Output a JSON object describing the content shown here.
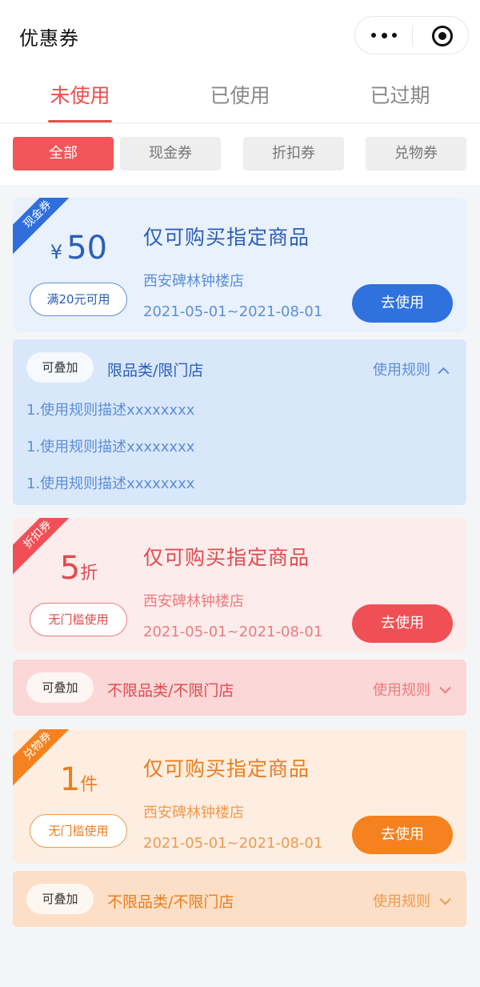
{
  "header": {
    "title": "优惠券",
    "menu_icon": "more-dots-icon",
    "close_icon": "close-target-icon"
  },
  "tabs": [
    {
      "label": "未使用",
      "active": true
    },
    {
      "label": "已使用",
      "active": false
    },
    {
      "label": "已过期",
      "active": false
    }
  ],
  "filters": [
    {
      "label": "全部",
      "active": true
    },
    {
      "label": "现金券",
      "active": false
    },
    {
      "label": "折扣券",
      "active": false
    },
    {
      "label": "兑物券",
      "active": false
    }
  ],
  "coupons": [
    {
      "type": "现金券",
      "currency": "¥",
      "value": "50",
      "unit": "",
      "condition": "满20元可用",
      "title": "仅可购买指定商品",
      "store": "西安碑林钟楼店",
      "dates": "2021-05-01~2021-08-01",
      "action": "去使用",
      "stackable": "可叠加",
      "scope": "限品类/限门店",
      "rules_label": "使用规则",
      "expanded": true,
      "rules": [
        "1.使用规则描述xxxxxxxx",
        "1.使用规则描述xxxxxxxx",
        "1.使用规则描述xxxxxxxx"
      ],
      "color": "#2f72de"
    },
    {
      "type": "折扣券",
      "currency": "",
      "value": "5",
      "unit": "折",
      "condition": "无门槛使用",
      "title": "仅可购买指定商品",
      "store": "西安碑林钟楼店",
      "dates": "2021-05-01~2021-08-01",
      "action": "去使用",
      "stackable": "可叠加",
      "scope": "不限品类/不限门店",
      "rules_label": "使用规则",
      "expanded": false,
      "color": "#f04f55"
    },
    {
      "type": "兑物券",
      "currency": "",
      "value": "1",
      "unit": "件",
      "condition": "无门槛使用",
      "title": "仅可购买指定商品",
      "store": "西安碑林钟楼店",
      "dates": "2021-05-01~2021-08-01",
      "action": "去使用",
      "stackable": "可叠加",
      "scope": "不限品类/不限门店",
      "rules_label": "使用规则",
      "expanded": false,
      "color": "#f5821f"
    }
  ]
}
